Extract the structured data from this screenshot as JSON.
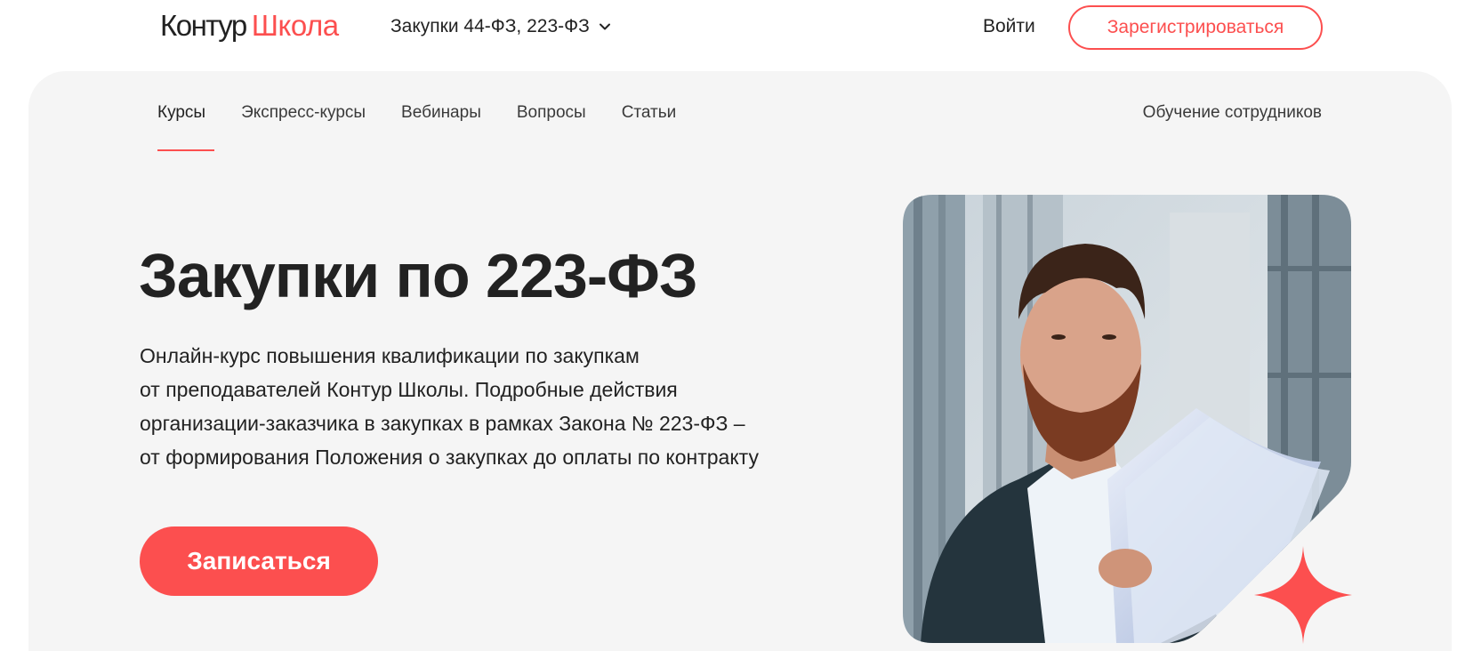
{
  "header": {
    "logo_part1": "Контур",
    "logo_part2": "Школа",
    "category_label": "Закупки 44-ФЗ, 223-ФЗ",
    "login_label": "Войти",
    "register_label": "Зарегистрироваться"
  },
  "nav": {
    "items": [
      {
        "label": "Курсы",
        "active": true
      },
      {
        "label": "Экспресс-курсы",
        "active": false
      },
      {
        "label": "Вебинары",
        "active": false
      },
      {
        "label": "Вопросы",
        "active": false
      },
      {
        "label": "Статьи",
        "active": false
      }
    ],
    "right_label": "Обучение сотрудников"
  },
  "hero": {
    "title": "Закупки по 223-ФЗ",
    "description_lines": [
      "Онлайн-курс повышения квалификации по закупкам",
      "от преподавателей Контур Школы. Подробные действия",
      "организации-заказчика в закупках в рамках Закона № 223-ФЗ –",
      "от формирования Положения о закупках до оплаты по контракту"
    ],
    "cta_label": "Записаться",
    "image_label": "man-reading-documents-photo"
  },
  "colors": {
    "accent": "#fc4f4f",
    "panel_bg": "#f5f5f5",
    "text": "#222222"
  }
}
